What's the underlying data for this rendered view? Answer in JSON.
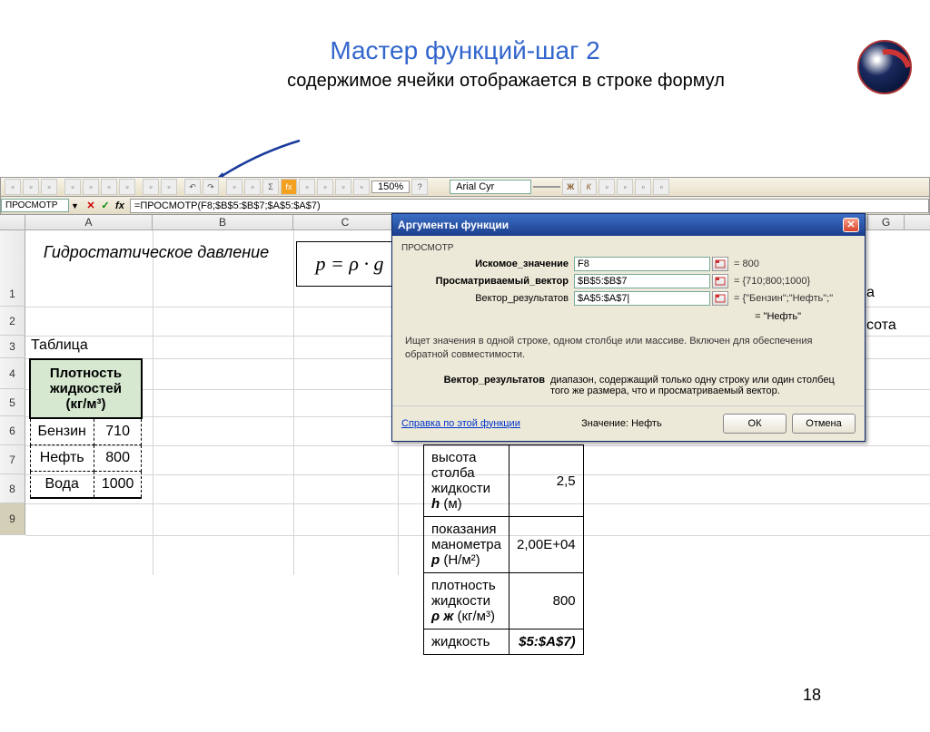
{
  "slide": {
    "title": "Мастер функций-шаг 2",
    "subtitle": "содержимое ячейки отображается в строке формул",
    "page_number": "18"
  },
  "toolbar": {
    "zoom": "150%",
    "font_name": "Arial Cyr",
    "font_size": ""
  },
  "formula_bar": {
    "name_box": "ПРОСМОТР",
    "formula": "=ПРОСМОТР(F8;$B$5:$B$7;$A$5:$A$7)"
  },
  "columns": [
    "A",
    "B",
    "C",
    "G"
  ],
  "rows": [
    "1",
    "2",
    "3",
    "4",
    "5",
    "6",
    "7",
    "8",
    "9"
  ],
  "sheet": {
    "hydro_title": "Гидростатическое давление",
    "formula_display": "p = ρ · g",
    "table_label": "Таблица",
    "density_header": "Плотность жидкостей (кг/м³)",
    "density_rows": [
      {
        "name": "Бензин",
        "value": "710"
      },
      {
        "name": "Нефть",
        "value": "800"
      },
      {
        "name": "Вода",
        "value": "1000"
      }
    ],
    "params": [
      {
        "label_pre": "высота столба жидкости ",
        "sym": "h",
        "unit": " (м)",
        "value": "2,5"
      },
      {
        "label_pre": "показания манометра ",
        "sym": "p",
        "unit": " (Н/м²)",
        "value": "2,00E+04"
      },
      {
        "label_pre": "плотность жидкости ",
        "sym": "ρ ж",
        "unit": " (кг/м³)",
        "value": "800"
      },
      {
        "label_pre": "жидкость",
        "sym": "",
        "unit": "",
        "value": "$5:$A$7)"
      }
    ],
    "far_text_1": "а",
    "far_text_2": "сота"
  },
  "dialog": {
    "title": "Аргументы функции",
    "func_name": "ПРОСМОТР",
    "args": [
      {
        "label": "Искомое_значение",
        "value": "F8",
        "result": "= 800",
        "bold": true
      },
      {
        "label": "Просматриваемый_вектор",
        "value": "$B$5:$B$7",
        "result": "= {710;800;1000}",
        "bold": true
      },
      {
        "label": "Вектор_результатов",
        "value": "$A$5:$A$7|",
        "result": "= {\"Бензин\";\"Нефть\";\"",
        "bold": false
      }
    ],
    "overall_result": "= \"Нефть\"",
    "description": "Ищет значения в одной строке, одном столбце или массиве. Включен для обеспечения обратной совместимости.",
    "arg_help_label": "Вектор_результатов",
    "arg_help_text": "диапазон, содержащий только одну строку или один столбец того же размера, что и просматриваемый вектор.",
    "help_link": "Справка по этой функции",
    "value_label": "Значение:",
    "value_result": "Нефть",
    "ok": "ОК",
    "cancel": "Отмена"
  }
}
